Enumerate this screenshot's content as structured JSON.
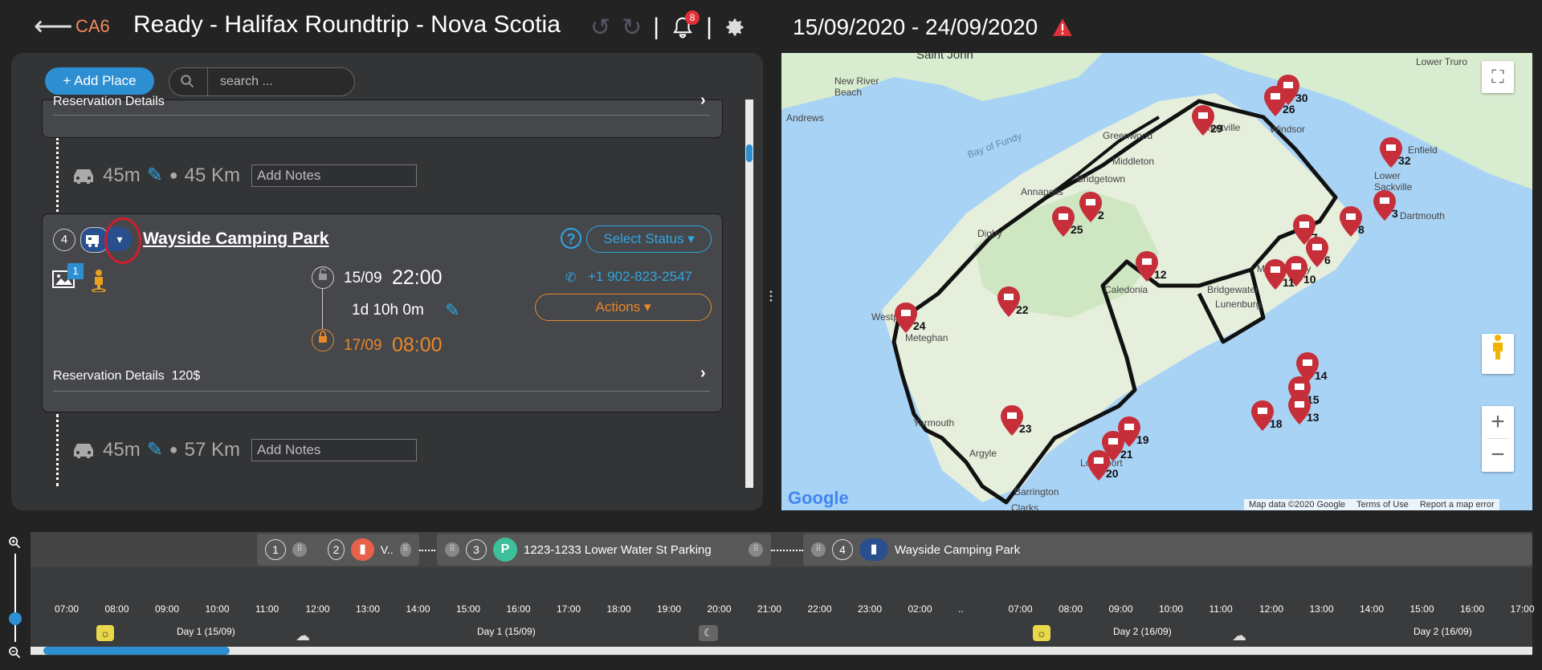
{
  "header": {
    "trip_code": "CA6",
    "title": "Ready - Halifax Roundtrip - Nova Scotia",
    "notifications_count": "8",
    "date_range": "15/09/2020 - 24/09/2020"
  },
  "toolbar": {
    "add_place_label": "+ Add Place",
    "search_placeholder": "search ..."
  },
  "top_card": {
    "reservation_label": "Reservation Details"
  },
  "travel_1": {
    "duration": "45m",
    "distance": "45 Km",
    "notes_placeholder": "Add Notes"
  },
  "place": {
    "number": "4",
    "name": "Wayside Camping Park",
    "status_button": "Select Status",
    "photo_count": "1",
    "phone": "+1 902-823-2547",
    "arrive_date": "15/09",
    "arrive_time": "22:00",
    "stay_duration": "1d 10h 0m",
    "depart_date": "17/09",
    "depart_time": "08:00",
    "actions_button": "Actions",
    "reservation_label": "Reservation Details",
    "reservation_price": "120$"
  },
  "travel_2": {
    "duration": "45m",
    "distance": "57 Km",
    "notes_placeholder": "Add Notes"
  },
  "map": {
    "towns": [
      "Saint John",
      "New River Beach",
      "Andrews",
      "Bay of Fundy",
      "Greenwood",
      "Kentville",
      "Windsor",
      "Middleton",
      "Bridgetown",
      "Annapolis",
      "Digby",
      "Yarmouth",
      "Meteghan",
      "Caledonia",
      "Bridgewater",
      "Lunenburg",
      "Mahone Bay",
      "Dartmouth",
      "Lower Sackville",
      "Lower Truro",
      "Argyle",
      "Lockeport",
      "Barrington",
      "Clarks",
      "Westport",
      "Enfield"
    ],
    "markers": [
      "30",
      "26",
      "29",
      "32",
      "3",
      "8",
      "7",
      "6",
      "10",
      "11",
      "12",
      "25",
      "2",
      "22",
      "24",
      "14",
      "15",
      "13",
      "18",
      "19",
      "21",
      "20",
      "23"
    ],
    "footer": [
      "Map data ©2020 Google",
      "Terms of Use",
      "Report a map error"
    ],
    "google_logo": "Google"
  },
  "timeline": {
    "stops": [
      {
        "number": "1",
        "label": ""
      },
      {
        "number": "2",
        "label": "V.."
      },
      {
        "number": "3",
        "label": "1223-1233 Lower Water St Parking"
      },
      {
        "number": "4",
        "label": "Wayside Camping Park"
      }
    ],
    "hours": [
      "07:00",
      "08:00",
      "09:00",
      "10:00",
      "11:00",
      "12:00",
      "13:00",
      "14:00",
      "15:00",
      "16:00",
      "17:00",
      "18:00",
      "19:00",
      "20:00",
      "21:00",
      "22:00",
      "23:00",
      "02:00",
      "..",
      "07:00",
      "08:00",
      "09:00",
      "10:00",
      "11:00",
      "12:00",
      "13:00",
      "14:00",
      "15:00",
      "16:00",
      "17:00"
    ],
    "day_labels": [
      "Day 1 (15/09)",
      "Day 1 (15/09)",
      "Day 2 (16/09)",
      "Day 2 (16/09)"
    ]
  },
  "colors": {
    "accent_blue": "#2d8fd2",
    "accent_orange": "#e8882a",
    "code_orange": "#f08a5d",
    "marker_red": "#c62f3a",
    "badge_red": "#e0303a"
  }
}
